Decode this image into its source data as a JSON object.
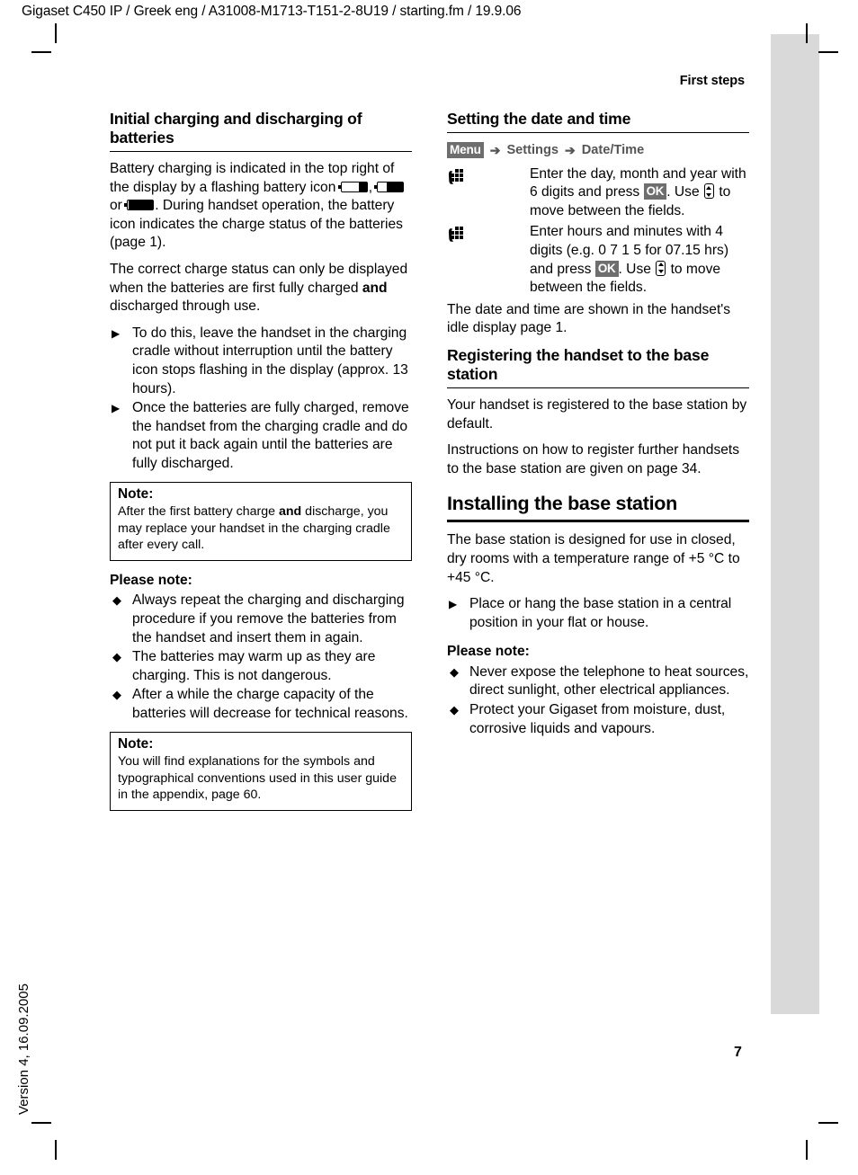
{
  "header": {
    "doc_line": "Gigaset C450 IP / Greek eng / A31008-M1713-T151-2-8U19 / starting.fm / 19.9.06",
    "section_label": "First steps"
  },
  "sidebar": {
    "version_text": "Version 4, 16.09.2005"
  },
  "footer": {
    "page_number": "7"
  },
  "left_column": {
    "heading": "Initial charging and discharging of batteries",
    "para_1_a": "Battery charging is indicated in the top right of the display by a flashing battery icon ",
    "para_1_b": ", ",
    "para_1_c": " or ",
    "para_1_d": ". During handset operation, the battery icon indicates the charge status of the batteries (page 1).",
    "para_2_a": "The correct charge status can only be displayed when the batteries are first fully charged ",
    "para_2_bold": "and",
    "para_2_b": " discharged through use.",
    "steps": [
      "To do this, leave the handset in the charging cradle without interruption until the battery icon stops flashing in the display (approx. 13 hours).",
      "Once the batteries are fully charged, remove the handset from the charging cradle and do not put it back again until the batteries are fully discharged."
    ],
    "note_1": {
      "title": "Note:",
      "text_a": "After the first battery charge ",
      "text_bold": "and",
      "text_b": " discharge, you may replace your handset in the charging cradle after every call."
    },
    "please_note_title": "Please note:",
    "please_note_items": [
      "Always repeat the charging and discharging procedure if you remove the batteries from the handset and insert them in again.",
      "The batteries may warm up as they are charging. This is not dangerous.",
      "After a while the charge capacity of the batteries will decrease for technical reasons."
    ],
    "note_2": {
      "title": "Note:",
      "text": "You will find explanations for the symbols and typographical conventions used in this user guide in the appendix, page 60."
    }
  },
  "right_column": {
    "heading_datetime": "Setting the date and time",
    "menu_path": {
      "menu_badge": "Menu",
      "arrow": "➔",
      "item_1": "Settings",
      "item_2": "Date/Time"
    },
    "step_1": {
      "text_a": "Enter the day, month and year with 6 digits and press ",
      "ok_badge": "OK",
      "text_b": ". Use ",
      "text_c": " to move between the fields."
    },
    "step_2": {
      "text_a": "Enter hours and minutes with 4 digits (e.g. 0 7 1 5 for 07.15 hrs) and press ",
      "ok_badge": "OK",
      "text_b": ". Use ",
      "text_c": " to move between the fields."
    },
    "para_datetime": "The date and time are shown in the handset's idle display page 1.",
    "heading_register": "Registering the handset to the base station",
    "para_register_1": "Your handset is registered to the base station by default.",
    "para_register_2": "Instructions on how to register further handsets to the base station are given on page 34.",
    "heading_install": "Installing the base station",
    "para_install_1": "The base station is designed for use in closed, dry rooms with a temperature range of +5 °C to +45 °C.",
    "install_steps": [
      "Place or hang the base station in a central position in your flat or house."
    ],
    "please_note_title": "Please note:",
    "please_note_items": [
      "Never expose the telephone to heat sources, direct sunlight, other electrical appliances.",
      "Protect your Gigaset from moisture, dust, corrosive liquids and vapours."
    ]
  },
  "icons": {
    "battery_low": "battery-low-icon",
    "battery_mid": "battery-medium-icon",
    "battery_full": "battery-full-icon",
    "keypad": "keypad-digit-entry-icon",
    "navkey": "navigation-control-key-icon",
    "bullet_diamond": "◆",
    "bullet_triangle": "▶"
  },
  "colors": {
    "badge_background": "#6e6e6e",
    "tab_bar": "#d9d9d9",
    "text": "#000000"
  }
}
